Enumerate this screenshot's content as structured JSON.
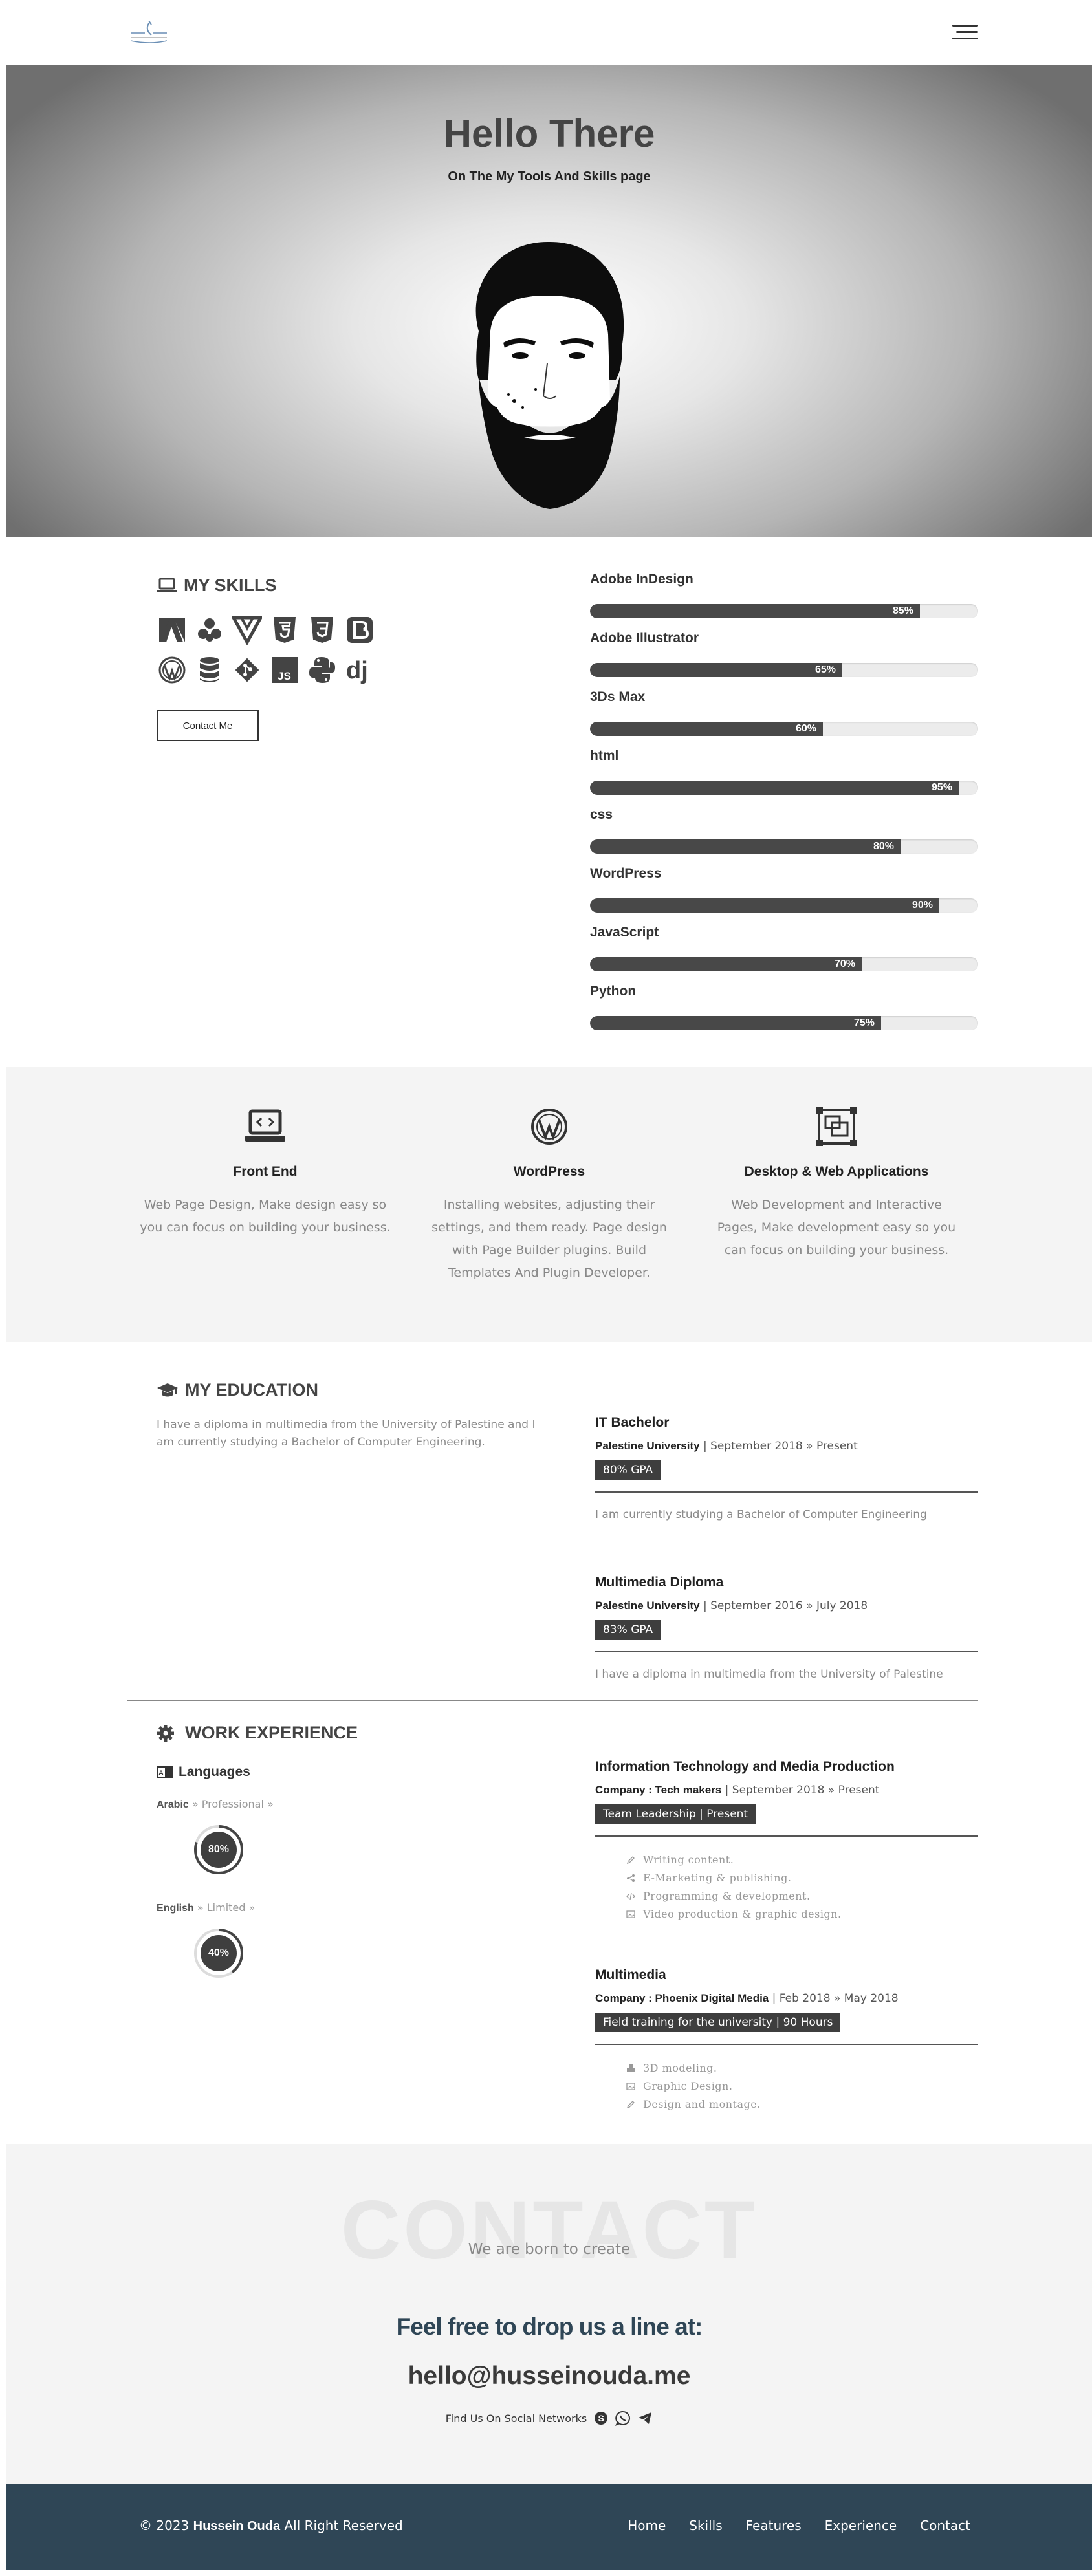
{
  "nav": {
    "menu_icon": "hamburger-icon",
    "logo_icon": "logo-icon"
  },
  "hero": {
    "title": "Hello There",
    "subtitle": "On The My Tools And Skills page"
  },
  "skills": {
    "heading": "MY SKILLS",
    "heading_icon": "laptop-icon",
    "tech_icons": [
      "adobe-icon",
      "dropbox-icon",
      "vuejs-icon",
      "html5-icon",
      "css3-icon",
      "bootstrap-icon",
      "wordpress-icon",
      "database-icon",
      "git-icon",
      "js-icon",
      "python-icon",
      "django-icon"
    ],
    "contact_button": "Contact Me",
    "bars": [
      {
        "label": "Adobe InDesign",
        "percent": 85,
        "percent_label": "85%"
      },
      {
        "label": "Adobe Illustrator",
        "percent": 65,
        "percent_label": "65%"
      },
      {
        "label": "3Ds Max",
        "percent": 60,
        "percent_label": "60%"
      },
      {
        "label": "html",
        "percent": 95,
        "percent_label": "95%"
      },
      {
        "label": "css",
        "percent": 80,
        "percent_label": "80%"
      },
      {
        "label": "WordPress",
        "percent": 90,
        "percent_label": "90%"
      },
      {
        "label": "JavaScript",
        "percent": 70,
        "percent_label": "70%"
      },
      {
        "label": "Python",
        "percent": 75,
        "percent_label": "75%"
      }
    ]
  },
  "services": [
    {
      "title": "Front End",
      "icon": "laptop-code-icon",
      "text": "Web Page Design, Make design easy so you can focus on building your business."
    },
    {
      "title": "WordPress",
      "icon": "wordpress-icon",
      "text": "Installing websites, adjusting their settings, and them ready. Page design with Page Builder plugins. Build Templates And Plugin Developer."
    },
    {
      "title": "Desktop & Web Applications",
      "icon": "object-group-icon",
      "text": "Web Development and Interactive Pages, Make development easy so you can focus on building your business."
    }
  ],
  "education": {
    "heading": "MY EDUCATION",
    "heading_icon": "graduation-cap-icon",
    "intro": "I have a diploma in multimedia from the University of Palestine and I am currently studying a Bachelor of Computer Engineering.",
    "entries": [
      {
        "title": "IT Bachelor",
        "org": "Palestine University",
        "dates": " | September 2018 » Present",
        "badge": "80% GPA",
        "desc": "I am currently studying a Bachelor of Computer Engineering"
      },
      {
        "title": "Multimedia Diploma",
        "org": "Palestine University",
        "dates": " | September 2016 » July 2018",
        "badge": "83% GPA",
        "desc": "I have a diploma in multimedia from the University of Palestine"
      }
    ]
  },
  "work": {
    "heading": "WORK EXPERIENCE",
    "heading_icon": "cog-icon",
    "languages_heading": "Languages",
    "languages_icon": "language-icon",
    "languages": [
      {
        "name": "Arabic",
        "level": " » Professional »",
        "percent": 80,
        "percent_label": "80%"
      },
      {
        "name": "English",
        "level": " » Limited »",
        "percent": 40,
        "percent_label": "40%"
      }
    ],
    "jobs": [
      {
        "title": "Information Technology and Media Production",
        "company_label": "Company : Tech makers",
        "dates": " | September 2018 » Present",
        "badge": "Team Leadership | Present",
        "tasks": [
          {
            "icon": "pen-icon",
            "text": "Writing content."
          },
          {
            "icon": "share-icon",
            "text": "E-Marketing & publishing."
          },
          {
            "icon": "code-icon",
            "text": "Programming & development."
          },
          {
            "icon": "image-icon",
            "text": "Video production & graphic design."
          }
        ]
      },
      {
        "title": "Multimedia",
        "company_label": "Company : Phoenix Digital Media",
        "dates": " | Feb 2018 » May 2018",
        "badge": "Field training for the university | 90 Hours",
        "tasks": [
          {
            "icon": "cubes-icon",
            "text": "3D modeling."
          },
          {
            "icon": "image-icon",
            "text": "Graphic Design."
          },
          {
            "icon": "pencil-icon",
            "text": "Design and montage."
          }
        ]
      }
    ]
  },
  "contact": {
    "bg_word": "CONTACT",
    "subtitle": "We are born to create",
    "line": "Feel free to drop us a line at:",
    "email": "hello@husseinouda.me",
    "social_label": "Find Us On Social Networks",
    "social_icons": [
      "skype-icon",
      "whatsapp-icon",
      "telegram-icon"
    ]
  },
  "footer": {
    "copyright_prefix": "© 2023 ",
    "owner": "Hussein Ouda",
    "copyright_suffix": " All Right Reserved",
    "links": [
      "Home",
      "Skills",
      "Features",
      "Experience",
      "Contact"
    ]
  }
}
